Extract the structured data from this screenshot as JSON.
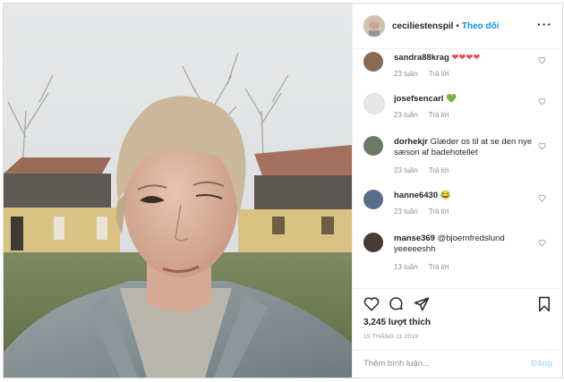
{
  "header": {
    "username": "ceciliestenspil",
    "separator": "•",
    "follow_label": "Theo dõi",
    "more_label": "···"
  },
  "comments": [
    {
      "username": "sandra88krag",
      "text": "❤❤❤❤",
      "time": "23 tuần",
      "reply": "Trả lời",
      "avatar_color": "#8a6a55"
    },
    {
      "username": "josefsencarl",
      "text": "💚",
      "time": "23 tuần",
      "reply": "Trả lời",
      "avatar_color": "#e8e8e8"
    },
    {
      "username": "dorhekjr",
      "text": "Glæder os til at se den nye sæson af badehotellet",
      "time": "23 tuần",
      "reply": "Trả lời",
      "avatar_color": "#6a7a62"
    },
    {
      "username": "hanne6430",
      "text": "😂",
      "time": "23 tuần",
      "reply": "Trả lời",
      "avatar_color": "#5a6e8a"
    },
    {
      "username": "manse369",
      "text": "@bjoernfredslund yeeeeeshh",
      "time": "13 tuần",
      "reply": "Trả lời",
      "avatar_color": "#4a3a35"
    }
  ],
  "post": {
    "likes": "3,245 lượt thích",
    "date": "15 THÁNG 11 2019",
    "comment_placeholder": "Thêm bình luận...",
    "post_label": "Đăng"
  },
  "icons": {
    "like": "heart-icon",
    "comment": "comment-bubble-icon",
    "share": "paper-plane-icon",
    "save": "bookmark-icon",
    "comment_like": "heart-outline-icon"
  }
}
